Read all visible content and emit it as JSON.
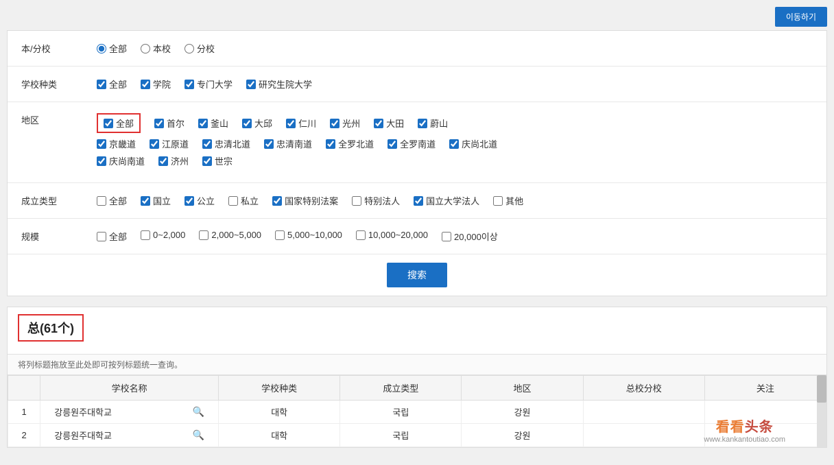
{
  "topButton": {
    "label": "이동하기"
  },
  "form": {
    "rows": [
      {
        "label": "本/分校",
        "type": "radio",
        "options": [
          {
            "label": "全部",
            "checked": true
          },
          {
            "label": "本校",
            "checked": false
          },
          {
            "label": "分校",
            "checked": false
          }
        ]
      },
      {
        "label": "学校种类",
        "type": "checkbox",
        "options": [
          {
            "label": "全部",
            "checked": true
          },
          {
            "label": "学院",
            "checked": true
          },
          {
            "label": "专门大学",
            "checked": true
          },
          {
            "label": "研究生院大学",
            "checked": true
          }
        ]
      },
      {
        "label": "地区",
        "type": "region",
        "rows": [
          [
            {
              "label": "全部",
              "checked": true,
              "highlighted": true
            },
            {
              "label": "首尔",
              "checked": true
            },
            {
              "label": "釜山",
              "checked": true
            },
            {
              "label": "大邱",
              "checked": true
            },
            {
              "label": "仁川",
              "checked": true
            },
            {
              "label": "光州",
              "checked": true
            },
            {
              "label": "大田",
              "checked": true
            },
            {
              "label": "蔚山",
              "checked": true
            }
          ],
          [
            {
              "label": "京畿道",
              "checked": true
            },
            {
              "label": "江原道",
              "checked": true
            },
            {
              "label": "忠清北道",
              "checked": true
            },
            {
              "label": "忠清南道",
              "checked": true
            },
            {
              "label": "全罗北道",
              "checked": true
            },
            {
              "label": "全罗南道",
              "checked": true
            },
            {
              "label": "庆尚北道",
              "checked": true
            }
          ],
          [
            {
              "label": "庆尚南道",
              "checked": true
            },
            {
              "label": "济州",
              "checked": true
            },
            {
              "label": "世宗",
              "checked": true
            }
          ]
        ]
      },
      {
        "label": "成立类型",
        "type": "checkbox",
        "options": [
          {
            "label": "全部",
            "checked": false
          },
          {
            "label": "国立",
            "checked": true
          },
          {
            "label": "公立",
            "checked": true
          },
          {
            "label": "私立",
            "checked": false
          },
          {
            "label": "国家特别法案",
            "checked": true
          },
          {
            "label": "特别法人",
            "checked": false
          },
          {
            "label": "国立大学法人",
            "checked": true
          },
          {
            "label": "其他",
            "checked": false
          }
        ]
      },
      {
        "label": "规模",
        "type": "checkbox",
        "options": [
          {
            "label": "全部",
            "checked": false
          },
          {
            "label": "0~2,000",
            "checked": false
          },
          {
            "label": "2,000~5,000",
            "checked": false
          },
          {
            "label": "5,000~10,000",
            "checked": false
          },
          {
            "label": "10,000~20,000",
            "checked": false
          },
          {
            "label": "20,000이상",
            "checked": false
          }
        ]
      }
    ],
    "searchButton": "搜索"
  },
  "results": {
    "count": "总(61个)",
    "dragHint": "将列标题拖放至此处即可按列标题统一查询。",
    "columns": [
      "",
      "学校名称",
      "学校种类",
      "成立类型",
      "地区",
      "总校分校",
      "关注"
    ],
    "rows": [
      {
        "num": 1,
        "name": "강릉원주대학교",
        "type": "대학",
        "established": "국립",
        "region": "강원",
        "branch": "",
        "note": ""
      },
      {
        "num": 2,
        "name": "강릉원주대학교",
        "type": "대학",
        "established": "국립",
        "region": "강원",
        "branch": "",
        "note": ""
      }
    ]
  },
  "watermark": {
    "title": "看看头条",
    "sub": "www.kankantoutiao.com"
  }
}
